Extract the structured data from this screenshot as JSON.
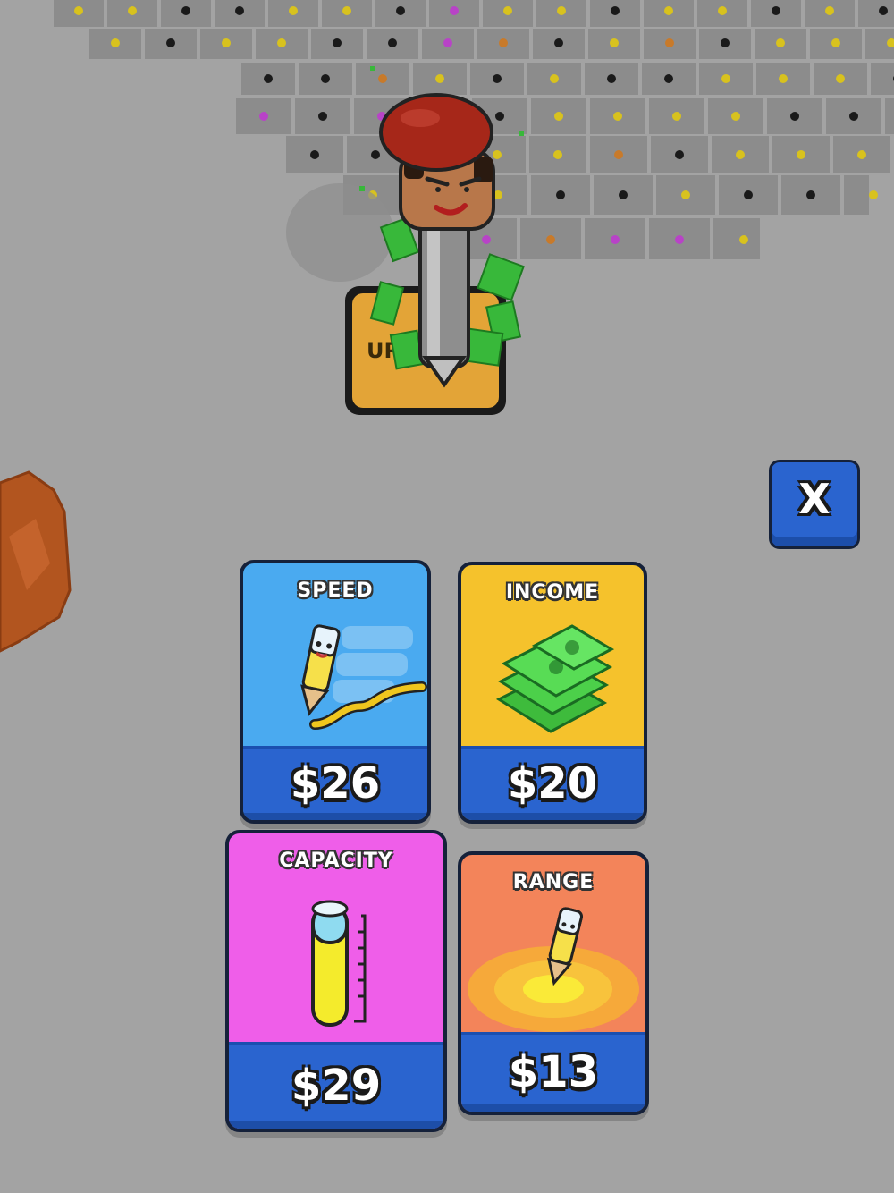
{
  "scene": {
    "upgrade_pad_label": "UP"
  },
  "close_button": {
    "label": "X"
  },
  "upgrades": {
    "speed": {
      "title": "SPEED",
      "price": "$26",
      "color": "#4aaaf0"
    },
    "income": {
      "title": "INCOME",
      "price": "$20",
      "color": "#f5c22c"
    },
    "capacity": {
      "title": "CAPACITY",
      "price": "$29",
      "color": "#ef5ee9"
    },
    "range": {
      "title": "RANGE",
      "price": "$13",
      "color": "#f3845a"
    }
  },
  "colors": {
    "ground": "#a3a3a3",
    "tile": "#8c8c8c",
    "price_bar": "#2a64cf",
    "card_border": "#15213a",
    "dot_colors": [
      "#1a1a1a",
      "#d8c21e",
      "#b843c7",
      "#c87a2a"
    ]
  }
}
